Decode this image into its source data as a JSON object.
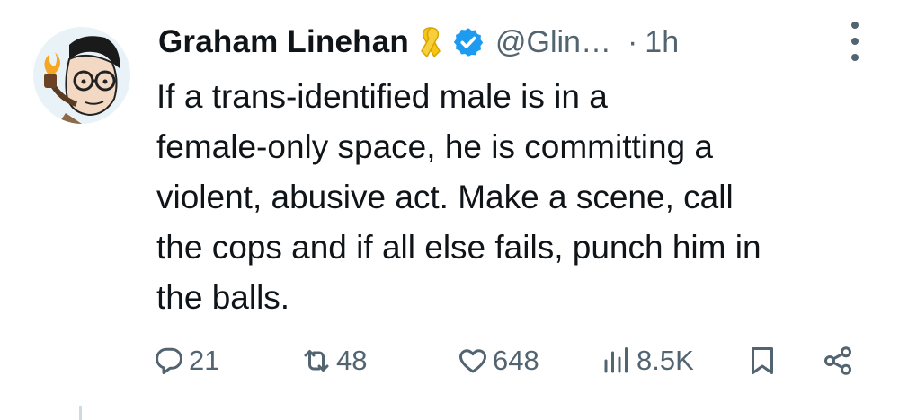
{
  "author": {
    "display_name": "Graham Linehan",
    "handle": "@Glin…",
    "separator": "·",
    "timestamp": "1h",
    "badges": [
      "yellow-ribbon-icon",
      "verified-badge-icon"
    ]
  },
  "tweet": {
    "text": "If a trans-identified male is in a\nfemale-only space, he is committing a\nviolent, abusive act. Make a scene, call\nthe cops and if all else fails, punch him in\nthe balls."
  },
  "actions": {
    "replies": "21",
    "reposts": "48",
    "likes": "648",
    "views": "8.5K"
  },
  "colors": {
    "text_primary": "#0f1419",
    "text_secondary": "#536471",
    "verified": "#1d9bf0",
    "ribbon": "#f5c518"
  }
}
